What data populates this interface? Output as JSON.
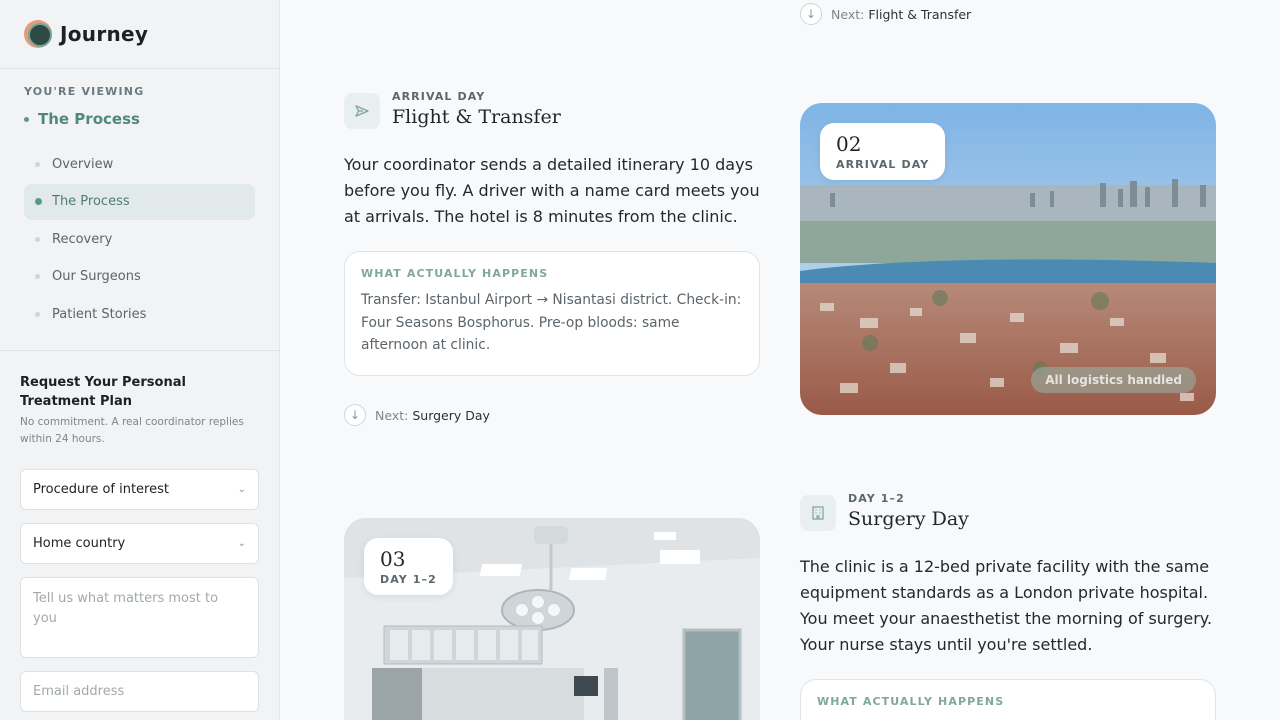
{
  "brand": {
    "name": "Journey"
  },
  "sidebar": {
    "viewing_label": "YOU'RE VIEWING",
    "current": "The Process",
    "items": [
      {
        "label": "Overview"
      },
      {
        "label": "The Process"
      },
      {
        "label": "Recovery"
      },
      {
        "label": "Our Surgeons"
      },
      {
        "label": "Patient Stories"
      }
    ]
  },
  "form": {
    "title": "Request Your Personal Treatment Plan",
    "subtitle": "No commitment. A real coordinator replies within 24 hours.",
    "procedure_placeholder": "Procedure of interest",
    "country_placeholder": "Home country",
    "message_placeholder": "Tell us what matters most to you",
    "email_placeholder": "Email address"
  },
  "main": {
    "top_next": {
      "label": "Next:",
      "target": "Flight & Transfer"
    },
    "step2": {
      "kicker": "ARRIVAL DAY",
      "title": "Flight & Transfer",
      "body": "Your coordinator sends a detailed itinerary 10 days before you fly. A driver with a name card meets you at arrivals. The hotel is 8 minutes from the clinic.",
      "happens_label": "WHAT ACTUALLY HAPPENS",
      "happens_text": "Transfer: Istanbul Airport → Nisantasi district. Check-in: Four Seasons Bosphorus. Pre-op bloods: same afternoon at clinic.",
      "next": {
        "label": "Next:",
        "target": "Surgery Day"
      },
      "badge_num": "02",
      "badge_cap": "ARRIVAL DAY",
      "photo_pill": "All logistics handled"
    },
    "step3": {
      "kicker": "DAY 1–2",
      "title": "Surgery Day",
      "body": "The clinic is a 12-bed private facility with the same equipment standards as a London private hospital. You meet your anaesthetist the morning of surgery. Your nurse stays until you're settled.",
      "happens_label": "WHAT ACTUALLY HAPPENS",
      "badge_num": "03",
      "badge_cap": "DAY 1–2"
    }
  }
}
